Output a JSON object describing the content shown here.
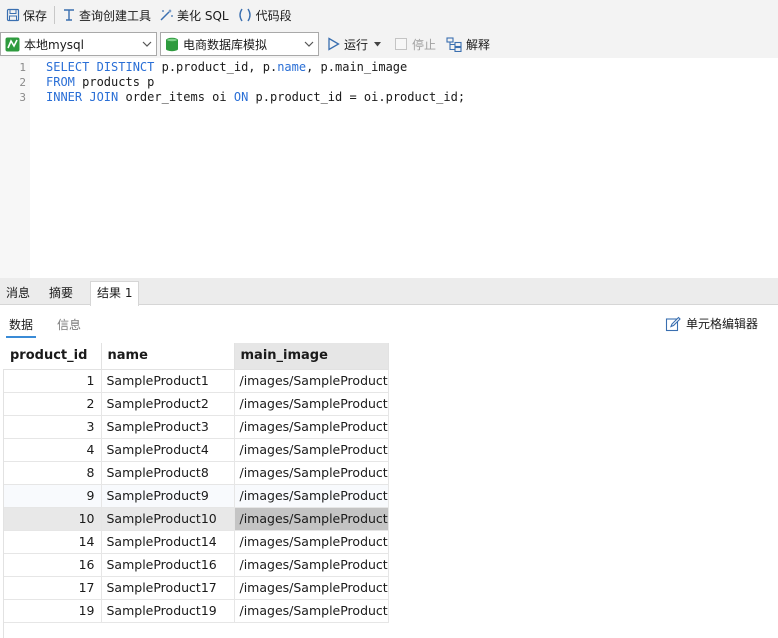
{
  "toolbar": {
    "save": "保存",
    "query_builder": "查询创建工具",
    "beautify": "美化 SQL",
    "snippet": "代码段"
  },
  "toolbar2": {
    "connection": "本地mysql",
    "database": "电商数据库模拟",
    "run": "运行",
    "stop": "停止",
    "explain": "解释"
  },
  "editor": {
    "lines": [
      {
        "num": "1",
        "parts": [
          {
            "t": "SELECT DISTINCT ",
            "kw": true
          },
          {
            "t": "p.product_id, p.",
            "kw": false
          },
          {
            "t": "name",
            "kw": true
          },
          {
            "t": ", p.main_image",
            "kw": false
          }
        ]
      },
      {
        "num": "2",
        "parts": [
          {
            "t": "FROM ",
            "kw": true
          },
          {
            "t": "products p",
            "kw": false
          }
        ]
      },
      {
        "num": "3",
        "parts": [
          {
            "t": "INNER JOIN ",
            "kw": true
          },
          {
            "t": "order_items oi ",
            "kw": false
          },
          {
            "t": "ON ",
            "kw": true
          },
          {
            "t": "p.product_id = oi.product_id;",
            "kw": false
          }
        ]
      }
    ]
  },
  "result_tabs": {
    "messages": "消息",
    "summary": "摘要",
    "result1": "结果 1"
  },
  "sub_tabs": {
    "data": "数据",
    "info": "信息",
    "cell_editor": "单元格编辑器"
  },
  "grid": {
    "columns": [
      "product_id",
      "name",
      "main_image"
    ],
    "rows": [
      [
        "1",
        "SampleProduct1",
        "/images/SampleProduct"
      ],
      [
        "2",
        "SampleProduct2",
        "/images/SampleProduct"
      ],
      [
        "3",
        "SampleProduct3",
        "/images/SampleProduct"
      ],
      [
        "4",
        "SampleProduct4",
        "/images/SampleProduct"
      ],
      [
        "8",
        "SampleProduct8",
        "/images/SampleProduct"
      ],
      [
        "9",
        "SampleProduct9",
        "/images/SampleProduct"
      ],
      [
        "10",
        "SampleProduct10",
        "/images/SampleProduct"
      ],
      [
        "14",
        "SampleProduct14",
        "/images/SampleProduct"
      ],
      [
        "16",
        "SampleProduct16",
        "/images/SampleProduct"
      ],
      [
        "17",
        "SampleProduct17",
        "/images/SampleProduct"
      ],
      [
        "19",
        "SampleProduct19",
        "/images/SampleProduct"
      ]
    ],
    "selected_row": 6,
    "selected_col": 2
  },
  "colors": {
    "keyword": "#2a6fd6",
    "accent": "#3a8bd6",
    "connection_icon": "#2e9b3e",
    "db_icon": "#2e9b3e"
  }
}
